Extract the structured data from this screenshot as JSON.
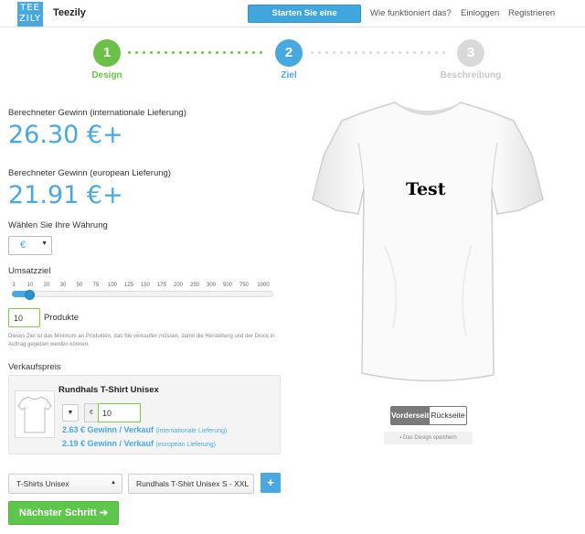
{
  "header": {
    "logo_top": "TEE",
    "logo_bottom": "ZILY",
    "brand": "Teezily",
    "campaign_button": "Starten Sie eine Kampagne",
    "nav": [
      "Wie funktioniert das?",
      "Einloggen",
      "Registrieren"
    ]
  },
  "steps": [
    {
      "number": "1",
      "label": "Design",
      "color": "#6cc04a"
    },
    {
      "number": "2",
      "label": "Ziel",
      "color": "#4aa8e0"
    },
    {
      "number": "3",
      "label": "Beschreibung",
      "color": "#d9d9d9"
    }
  ],
  "profit_international": {
    "label": "Berechneter Gewinn (internationale Lieferung)",
    "value": "26.30 €+"
  },
  "profit_european": {
    "label": "Berechneter Gewinn (european Lieferung)",
    "value": "21.91 €+"
  },
  "currency": {
    "label": "Wählen Sie Ihre Währung",
    "selected": "€"
  },
  "sales_goal": {
    "label": "Umsatzziel",
    "ticks": [
      "3",
      "10",
      "20",
      "30",
      "50",
      "75",
      "100",
      "125",
      "150",
      "175",
      "200",
      "250",
      "300",
      "500",
      "750",
      "1000"
    ],
    "selected_value": "10",
    "unit": "Produkte",
    "hint": "Dieses Ziel ist das Minimum an Produkten, das Sie verkaufen müssen, damit die Herstellung und der Druck in Auftrag gegeben werden können."
  },
  "sale_price": {
    "label": "Verkaufspreis",
    "product_name": "Rundhals T-Shirt Unisex",
    "currency_symbol": "€",
    "price": "10",
    "profit_lines": [
      {
        "amount": "2.63 € Gewinn / Verkauf",
        "note": "(internationale Lieferung)"
      },
      {
        "amount": "2.19 € Gewinn / Verkauf",
        "note": "(european Lieferung)"
      }
    ]
  },
  "product_selects": {
    "category": "T-Shirts Unisex",
    "product": "Rundhals T-Shirt Unisex S - XXL"
  },
  "add_button": "+",
  "next_button": "Nächster Schritt ➔",
  "preview": {
    "design_text": "Test",
    "front_label": "Vorderseite",
    "back_label": "Rückseite",
    "save_label": "Das Design speichern",
    "icons": {
      "save": "floppy-disk-icon",
      "dropdown": "caret-down-icon"
    }
  },
  "colors": {
    "accent": "#4aa8e0",
    "success": "#5ec64a",
    "muted": "#d9d9d9"
  }
}
